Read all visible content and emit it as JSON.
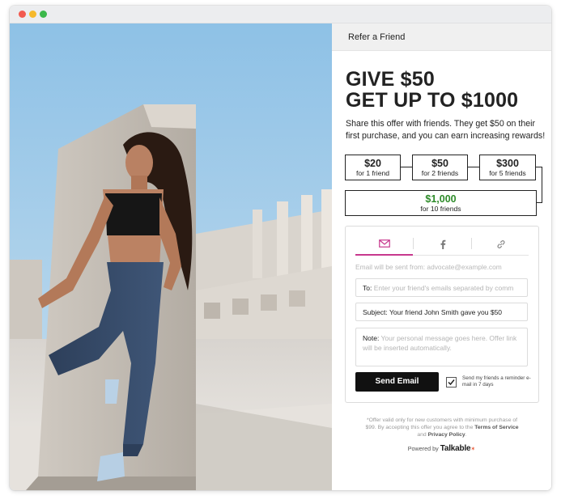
{
  "window": {
    "controls": [
      "close",
      "minimize",
      "maximize"
    ]
  },
  "panel": {
    "header_title": "Refer a Friend",
    "headline_1": "GIVE $50",
    "headline_2": "GET UP TO $1000",
    "subtext": "Share this offer with friends. They get $50 on their first purchase, and you can earn increasing rewards!",
    "tiers": [
      {
        "amount": "$20",
        "label": "for 1 friend"
      },
      {
        "amount": "$50",
        "label": "for 2 friends"
      },
      {
        "amount": "$300",
        "label": "for 5 friends"
      },
      {
        "amount": "$1,000",
        "label": "for 10 friends"
      }
    ],
    "colors": {
      "accent": "#c7388d",
      "reward_green": "#2e8b2a",
      "button": "#111111",
      "brand_orange": "#e8522e"
    },
    "tabs": [
      {
        "name": "email",
        "icon": "envelope-icon",
        "active": true
      },
      {
        "name": "facebook",
        "icon": "facebook-icon",
        "active": false
      },
      {
        "name": "link",
        "icon": "link-icon",
        "active": false
      }
    ],
    "from_line": "Email will be sent from: advocate@example.com",
    "to_label": "To:",
    "to_placeholder": "Enter your friend's emails separated by comm",
    "subject_label": "Subject:",
    "subject_value": "Your friend John Smith gave you $50",
    "note_label": "Note:",
    "note_placeholder": "Your personal message goes here. Offer link will be inserted automatically.",
    "send_label": "Send Email",
    "reminder_checked": true,
    "reminder_text": "Send my friends a reminder e-mail in 7 days",
    "disclaimer_1": "*Offer valid only for new customers with minimum purchase of $99. By accepting this offer you agree to the",
    "terms_link": "Terms of Service",
    "and_text": "and",
    "privacy_link": "Privacy Policy",
    "period": ".",
    "powered_by": "Powered by",
    "brand": "Talkable"
  }
}
